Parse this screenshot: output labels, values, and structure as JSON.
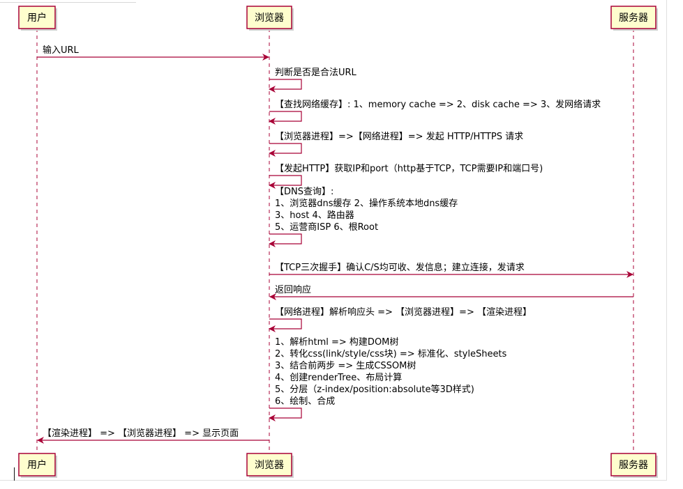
{
  "participants": [
    {
      "id": "user",
      "label": "用户"
    },
    {
      "id": "browser",
      "label": "浏览器"
    },
    {
      "id": "server",
      "label": "服务器"
    }
  ],
  "messages": [
    {
      "from": "user",
      "to": "browser",
      "lines": [
        "输入URL"
      ]
    },
    {
      "from": "browser",
      "to": "browser",
      "lines": [
        "判断是否是合法URL"
      ]
    },
    {
      "from": "browser",
      "to": "browser",
      "lines": [
        "【查找网络缓存】: 1、memory cache => 2、disk cache => 3、发网络请求"
      ]
    },
    {
      "from": "browser",
      "to": "browser",
      "lines": [
        "【浏览器进程】=>【网络进程】=> 发起 HTTP/HTTPS 请求"
      ]
    },
    {
      "from": "browser",
      "to": "browser",
      "lines": [
        "【发起HTTP】获取IP和port（http基于TCP，TCP需要IP和端口号)"
      ]
    },
    {
      "from": "browser",
      "to": "browser",
      "lines": [
        "【DNS查询】:",
        "1、浏览器dns缓存 2、操作系统本地dns缓存",
        "3、host 4、路由器",
        "5、运营商ISP 6、根Root"
      ]
    },
    {
      "from": "browser",
      "to": "server",
      "lines": [
        "【TCP三次握手】确认C/S均可收、发信息；建立连接，发请求"
      ]
    },
    {
      "from": "server",
      "to": "browser",
      "lines": [
        "返回响应"
      ]
    },
    {
      "from": "browser",
      "to": "browser",
      "lines": [
        "【网络进程】解析响应头 => 【浏览器进程】=> 【渲染进程】"
      ]
    },
    {
      "from": "browser",
      "to": "browser",
      "lines": [
        "1、解析html => 构建DOM树",
        "2、转化css(link/style/css块) => 标准化、styleSheets",
        "3、结合前两步 => 生成CSSOM树",
        "4、创建renderTree、布局计算",
        "5、分层（z-index/position:absolute等3D样式)",
        "6、绘制、合成"
      ]
    },
    {
      "from": "browser",
      "to": "user",
      "lines": [
        "【渲染进程】 => 【浏览器进程】 => 显示页面"
      ]
    }
  ],
  "colors": {
    "participant_fill": "#FEFECE",
    "participant_border": "#A80036",
    "arrow": "#A80036",
    "lifeline": "#A80036"
  }
}
